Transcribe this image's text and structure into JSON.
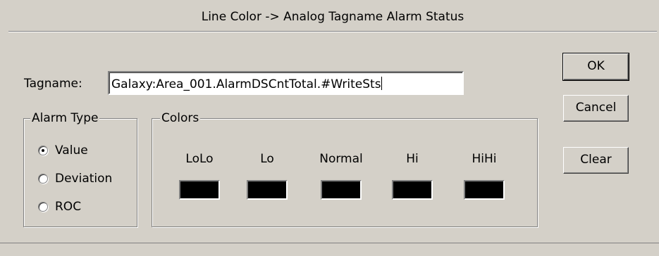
{
  "dialog": {
    "title": "Line Color -> Analog Tagname Alarm Status"
  },
  "tagname": {
    "label": "Tagname:",
    "value": "Galaxy:Area_001.AlarmDSCntTotal.#WriteSts"
  },
  "alarm_type": {
    "legend": "Alarm Type",
    "options": [
      {
        "label": "Value",
        "checked": true
      },
      {
        "label": "Deviation",
        "checked": false
      },
      {
        "label": "ROC",
        "checked": false
      }
    ]
  },
  "colors": {
    "legend": "Colors",
    "items": [
      {
        "label": "LoLo",
        "color": "#000000"
      },
      {
        "label": "Lo",
        "color": "#000000"
      },
      {
        "label": "Normal",
        "color": "#000000"
      },
      {
        "label": "Hi",
        "color": "#000000"
      },
      {
        "label": "HiHi",
        "color": "#000000"
      }
    ]
  },
  "buttons": {
    "ok": "OK",
    "cancel": "Cancel",
    "clear": "Clear"
  }
}
